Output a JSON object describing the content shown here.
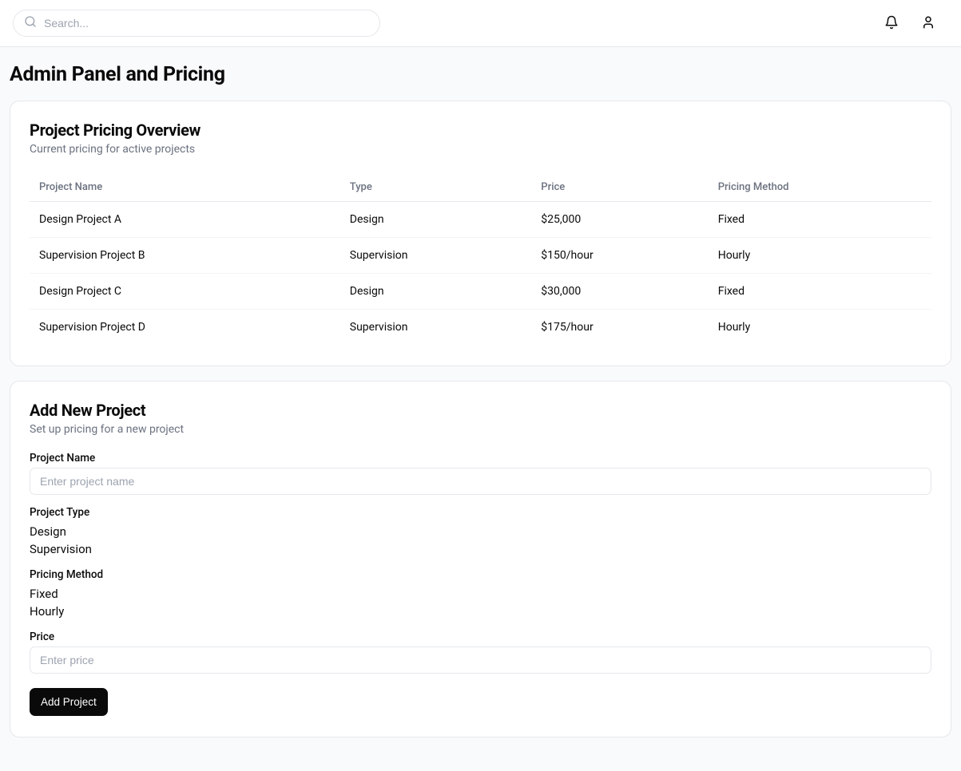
{
  "header": {
    "search_placeholder": "Search..."
  },
  "page": {
    "title": "Admin Panel and Pricing"
  },
  "overview": {
    "title": "Project Pricing Overview",
    "subtitle": "Current pricing for active projects",
    "columns": {
      "name": "Project Name",
      "type": "Type",
      "price": "Price",
      "method": "Pricing Method"
    },
    "rows": [
      {
        "name": "Design Project A",
        "type": "Design",
        "price": "$25,000",
        "method": "Fixed"
      },
      {
        "name": "Supervision Project B",
        "type": "Supervision",
        "price": "$150/hour",
        "method": "Hourly"
      },
      {
        "name": "Design Project C",
        "type": "Design",
        "price": "$30,000",
        "method": "Fixed"
      },
      {
        "name": "Supervision Project D",
        "type": "Supervision",
        "price": "$175/hour",
        "method": "Hourly"
      }
    ]
  },
  "addProject": {
    "title": "Add New Project",
    "subtitle": "Set up pricing for a new project",
    "fields": {
      "name_label": "Project Name",
      "name_placeholder": "Enter project name",
      "type_label": "Project Type",
      "type_options": [
        "Design",
        "Supervision"
      ],
      "method_label": "Pricing Method",
      "method_options": [
        "Fixed",
        "Hourly"
      ],
      "price_label": "Price",
      "price_placeholder": "Enter price"
    },
    "submit_label": "Add Project"
  }
}
